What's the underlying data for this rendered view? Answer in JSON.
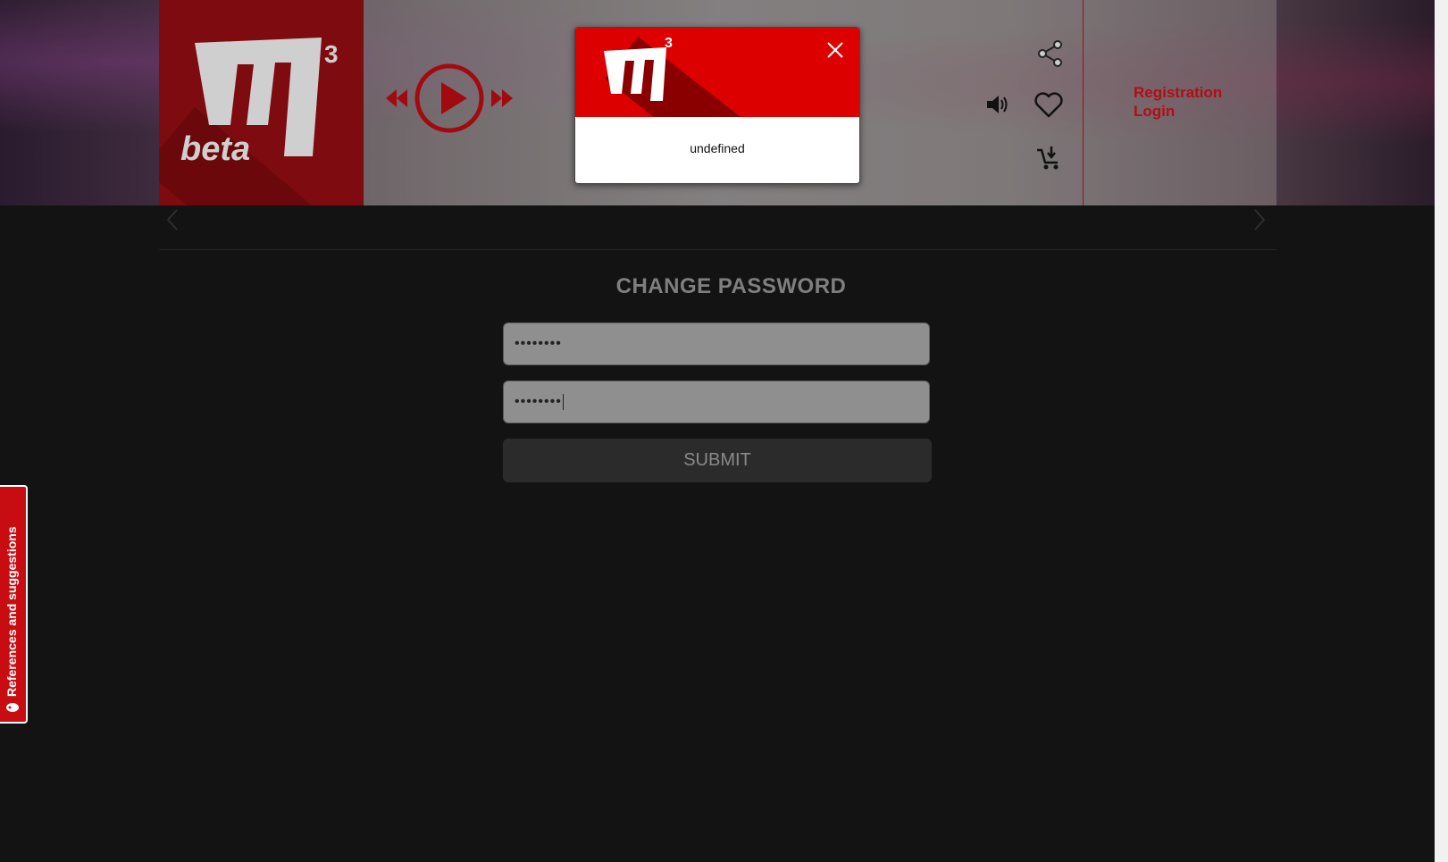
{
  "header": {
    "logo_alt": "m3 beta",
    "logo_text": "beta",
    "logo_exponent": "3",
    "auth": {
      "registration": "Registration",
      "login": "Login"
    }
  },
  "player": {
    "controls": [
      "rewind-icon",
      "play-icon",
      "fast-forward-icon"
    ]
  },
  "icons": [
    "share-icon",
    "volume-icon",
    "heart-icon",
    "cart-add-icon"
  ],
  "popup": {
    "exponent": "3",
    "message": "undefined"
  },
  "form": {
    "title": "CHANGE PASSWORD",
    "password_1": "••••••••",
    "password_2": "••••••••",
    "submit_label": "SUBMIT"
  },
  "side_tab": {
    "label": "References and suggestions"
  },
  "colors": {
    "accent": "#b00e13",
    "logo_red": "#7d0b0f",
    "popup_red": "#dd0000",
    "background": "#131313"
  }
}
